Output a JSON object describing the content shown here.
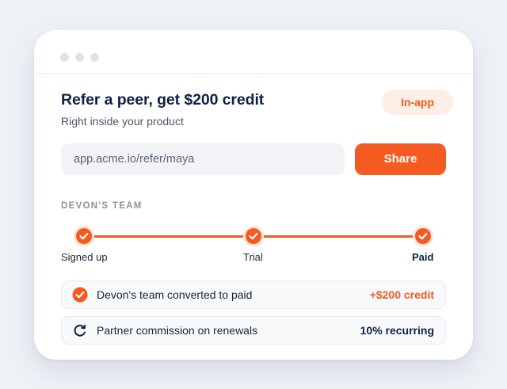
{
  "card": {
    "title": "Refer a peer, get $200 credit",
    "subtitle": "Right inside your product",
    "badge": "In-app"
  },
  "referral": {
    "link": "app.acme.io/refer/maya",
    "share_label": "Share"
  },
  "team": {
    "section_label": "DEVON'S TEAM",
    "steps": [
      {
        "label": "Signed up",
        "completed": true
      },
      {
        "label": "Trial",
        "completed": true
      },
      {
        "label": "Paid",
        "completed": true,
        "current": true
      }
    ],
    "progress_fraction": 1.0
  },
  "rows": [
    {
      "icon": "check-circle-icon",
      "text": "Devon's team converted to paid",
      "value": "+$200 credit"
    },
    {
      "icon": "refresh-icon",
      "text": "Partner commission on renewals",
      "value": "10% recurring"
    }
  ],
  "colors": {
    "accent": "#f55a21",
    "accent_soft": "#fdeee6",
    "heading": "#0f2146",
    "muted": "#8a92a1"
  }
}
